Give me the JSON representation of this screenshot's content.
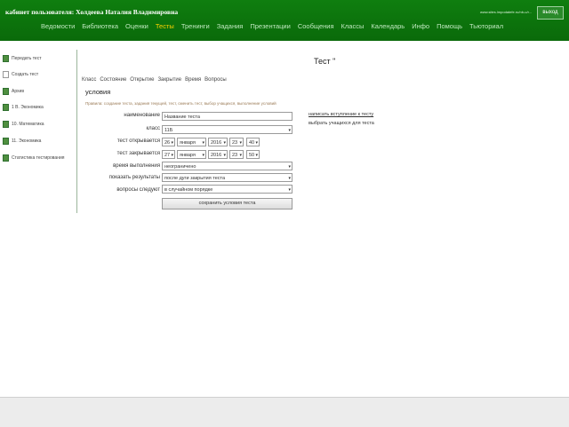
{
  "header": {
    "title": "кабинет пользователя: Холдеева Наталия Владимировна",
    "top_right_text": "www.sites.lmpodatefe.ru/nb-u/r...",
    "exit_label": "выход"
  },
  "nav": [
    "Ведомости",
    "Библиотека",
    "Оценки",
    "Тесты",
    "Тренинги",
    "Задания",
    "Презентации",
    "Сообщения",
    "Классы",
    "Календарь",
    "Инфо",
    "Помощь",
    "Тьюториал"
  ],
  "nav_active": "Тесты",
  "sidebar": {
    "items": [
      {
        "label": "Передать тест",
        "icon": "green-book-icon"
      },
      {
        "label": "Создать тест",
        "icon": "blank-page-icon"
      },
      {
        "label": "Архив",
        "icon": "green-book-icon"
      },
      {
        "label": "1 В. Экономика",
        "icon": "green-book-icon"
      },
      {
        "label": "10. Математика",
        "icon": "green-book-icon"
      },
      {
        "label": "11. Экономика",
        "icon": "green-book-icon"
      },
      {
        "label": "Статистика тестирования",
        "icon": "green-book-icon"
      }
    ]
  },
  "main": {
    "page_title": "Тест \"",
    "tabs": [
      "Класс",
      "Состояние",
      "Открытие",
      "Закрытие",
      "Время",
      "Вопросы"
    ],
    "section_title": "условия",
    "hint": "Правила: создание теста, задания текущей, тест, сменить тест, выбор учащихся, выполнение условий",
    "form": {
      "name_label": "наименование",
      "name_value": "Название теста",
      "class_label": "класс",
      "class_value": "11Б",
      "open_label": "тест открывается",
      "open_day": "26",
      "open_month": "января",
      "open_year": "2016",
      "open_hour": "23",
      "open_min": "40",
      "close_label": "тест закрывается",
      "close_day": "27",
      "close_month": "января",
      "close_year": "2016",
      "close_hour": "23",
      "close_min": "50",
      "time_label": "время выполнения",
      "time_value": "неограничено",
      "show_label": "показать результаты",
      "show_value": "после дуги закрытия теста",
      "order_label": "вопросы следуют",
      "order_value": "в случайном порядке",
      "link_add": "написать вступление к тесту",
      "link_students": "выбрать учащихся для теста",
      "save_label": "сохранить условия теста"
    }
  },
  "colors": {
    "header_green": "#0f7e0f",
    "active_nav": "#ffd200"
  }
}
